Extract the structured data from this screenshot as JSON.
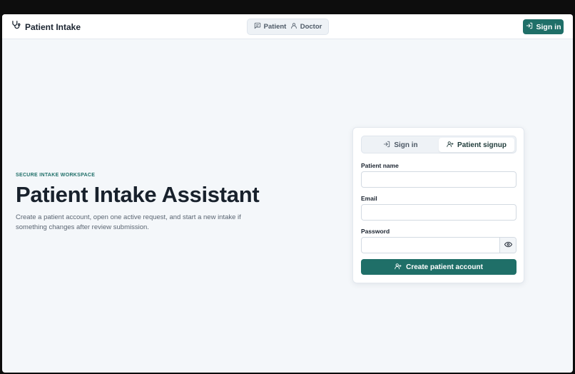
{
  "header": {
    "brand": "Patient Intake",
    "roles": [
      {
        "label": "Patient",
        "icon": "message-square-icon"
      },
      {
        "label": "Doctor",
        "icon": "user-icon"
      }
    ],
    "sign_in_label": "Sign in"
  },
  "hero": {
    "eyebrow": "SECURE INTAKE WORKSPACE",
    "title": "Patient Intake Assistant",
    "description": "Create a patient account, open one active request, and start a new intake if something changes after review submission."
  },
  "auth_card": {
    "tabs": [
      {
        "label": "Sign in",
        "icon": "log-in-icon",
        "active": false
      },
      {
        "label": "Patient signup",
        "icon": "user-plus-icon",
        "active": true
      }
    ],
    "fields": {
      "name_label": "Patient name",
      "name_value": "",
      "email_label": "Email",
      "email_value": "",
      "password_label": "Password",
      "password_value": ""
    },
    "submit_label": "Create patient account"
  },
  "colors": {
    "accent": "#1f6f68",
    "background": "#f4f7fa",
    "text": "#18212c"
  }
}
